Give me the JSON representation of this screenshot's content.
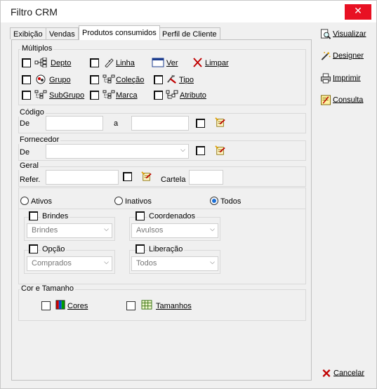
{
  "window": {
    "title": "Filtro CRM",
    "close": "✕"
  },
  "tabs": [
    {
      "label": "Exibição"
    },
    {
      "label": "Vendas"
    },
    {
      "label": "Produtos consumidos",
      "active": true
    },
    {
      "label": "Perfil de Cliente"
    }
  ],
  "multiplos": {
    "title": "Múltiplos",
    "items": [
      {
        "label": "Depto",
        "icon": "hierarchy-icon"
      },
      {
        "label": "Linha",
        "icon": "pencil-icon"
      },
      {
        "label": "Ver",
        "icon": "window-icon"
      },
      {
        "label": "Limpar",
        "icon": "red-x-icon"
      },
      {
        "label": "Grupo",
        "icon": "group-icon"
      },
      {
        "label": "Coleção",
        "icon": "tree-icon"
      },
      {
        "label": "Tipo",
        "icon": "tools-icon"
      },
      {
        "label": "SubGrupo",
        "icon": "tree-icon"
      },
      {
        "label": "Marca",
        "icon": "tree-icon"
      },
      {
        "label": "Atributo",
        "icon": "hierarchy-icon"
      }
    ]
  },
  "codigo": {
    "title": "Código",
    "de_label": "De",
    "a_label": "a",
    "de_value": "",
    "a_value": ""
  },
  "fornecedor": {
    "title": "Fornecedor",
    "de_label": "De",
    "value": ""
  },
  "geral": {
    "title": "Geral",
    "refer_label": "Refer.",
    "refer_value": "",
    "cartela_label": "Cartela",
    "cartela_value": ""
  },
  "status": {
    "options": [
      {
        "label": "Ativos",
        "selected": false
      },
      {
        "label": "Inativos",
        "selected": false
      },
      {
        "label": "Todos",
        "selected": true
      }
    ]
  },
  "brindes": {
    "title": "Brindes",
    "value": "Brindes"
  },
  "coordenados": {
    "title": "Coordenados",
    "value": "Avulsos"
  },
  "opcao": {
    "title": "Opção",
    "value": "Comprados"
  },
  "liberacao": {
    "title": "Liberação",
    "value": "Todos"
  },
  "cor_tamanho": {
    "title": "Cor e Tamanho",
    "cores_label": "Cores",
    "tamanhos_label": "Tamanhos"
  },
  "side": {
    "visualizar": "Visualizar",
    "designer": "Designer",
    "imprimir": "Imprimir",
    "consulta": "Consulta",
    "cancelar": "Cancelar"
  },
  "colors": {
    "accent": "#1c6fd6",
    "close": "#e81123",
    "danger": "#c00000"
  }
}
